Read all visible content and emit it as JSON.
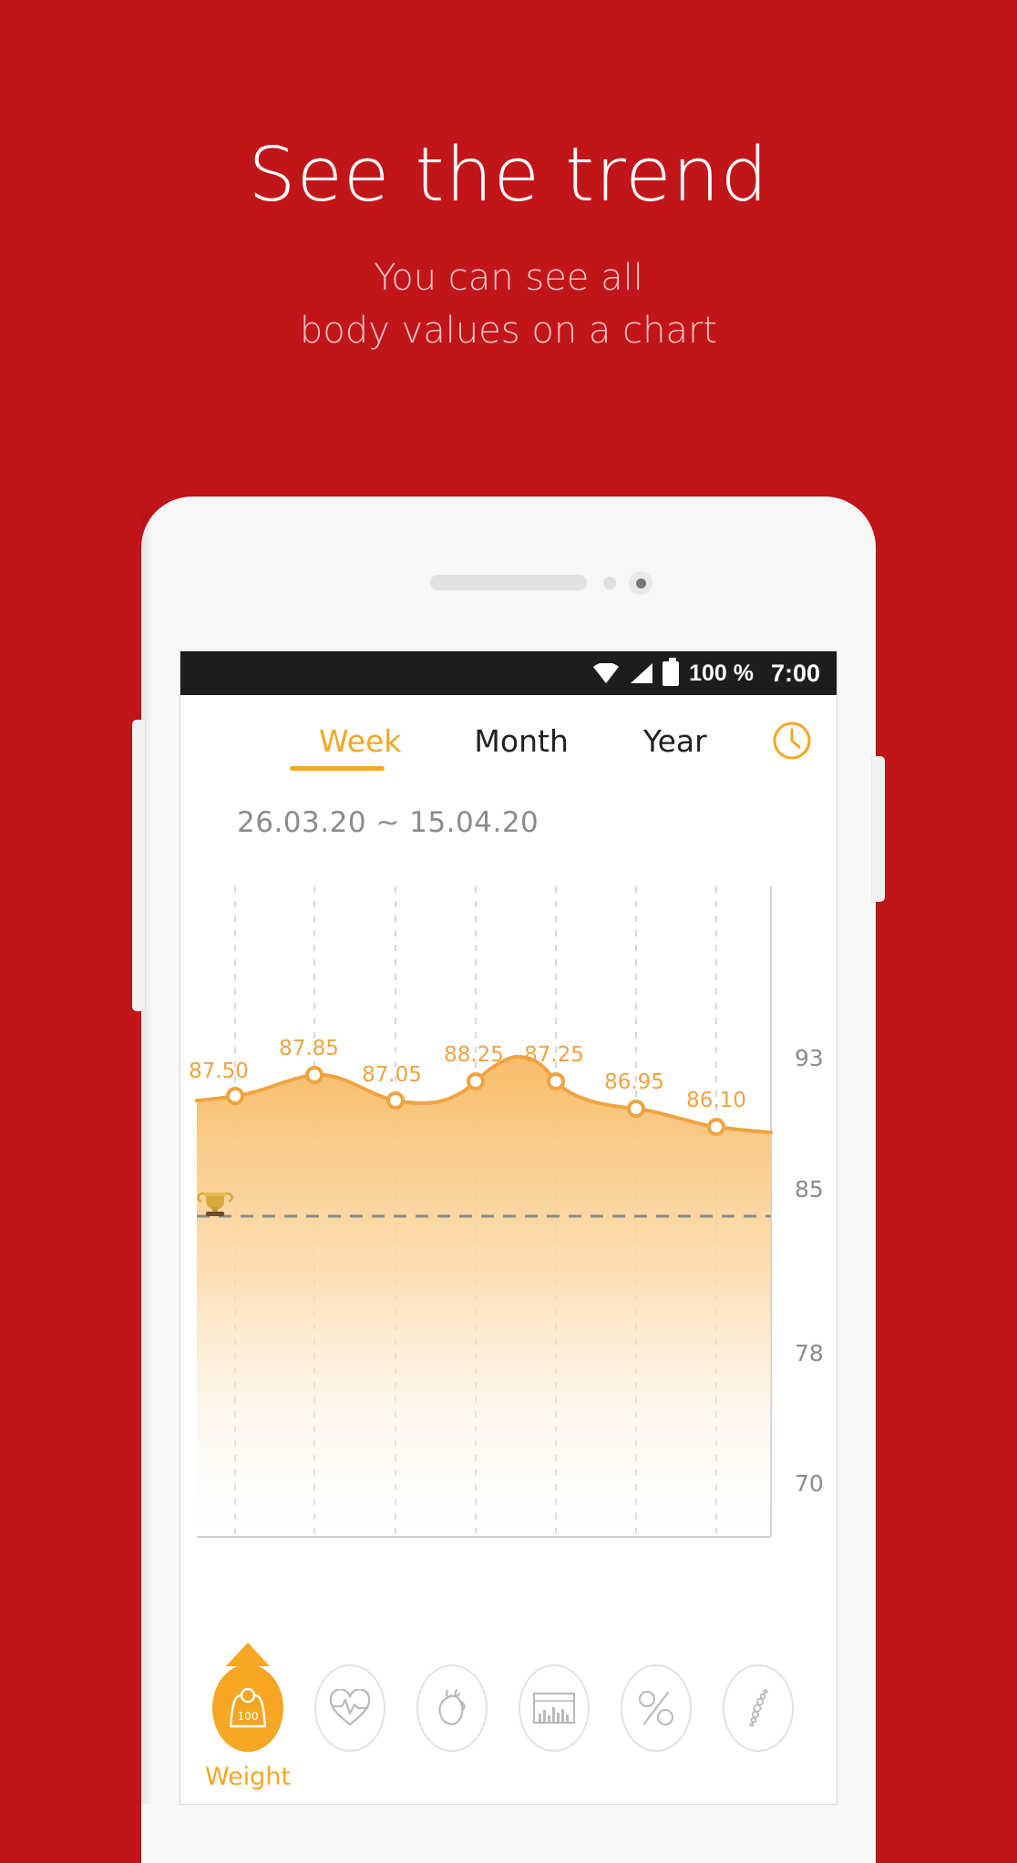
{
  "promo": {
    "title": "See the trend",
    "subtitle_line1": "You can see all",
    "subtitle_line2": "body values on a chart"
  },
  "colors": {
    "background_red": "#c1151a",
    "accent_orange": "#f5a623",
    "area_fill": "#f8c171",
    "muted_gray": "#8b8b8b",
    "statusbar": "#1d1d1d"
  },
  "statusbar": {
    "battery_text": "100 %",
    "time": "7:00",
    "icons": [
      "wifi-icon",
      "signal-icon",
      "battery-icon"
    ]
  },
  "tabs": [
    {
      "label": "Week",
      "active": true
    },
    {
      "label": "Month",
      "active": false
    },
    {
      "label": "Year",
      "active": false
    }
  ],
  "toolbar": {
    "history_icon": "clock-icon"
  },
  "date_range": "26.03.20 ~ 15.04.20",
  "chart_data": {
    "type": "area",
    "title": "",
    "xlabel": "",
    "ylabel": "",
    "ylim": [
      66,
      96
    ],
    "yticks": [
      93,
      85,
      78,
      70
    ],
    "grid": true,
    "gridlines_vertical": 7,
    "legend": "none",
    "unit": "kg",
    "categories": [
      "1",
      "2",
      "3",
      "4",
      "5",
      "6",
      "7"
    ],
    "values": [
      87.5,
      87.85,
      87.05,
      88.25,
      87.25,
      86.95,
      86.1
    ],
    "point_labels": [
      "87.50",
      "87.85",
      "87.05",
      "88.25",
      "87.25",
      "86.95",
      "86.10"
    ],
    "goal_line": {
      "value": 83.2,
      "style": "dashed",
      "marker_icon": "trophy-icon",
      "marker": "🏆"
    }
  },
  "bottom_nav": {
    "active_label": "Weight",
    "items": [
      {
        "icon": "weight-scale-icon",
        "label": "Weight",
        "active": true
      },
      {
        "icon": "heartbeat-icon",
        "label": "",
        "active": false
      },
      {
        "icon": "heart-organ-icon",
        "label": "",
        "active": false
      },
      {
        "icon": "body-chart-icon",
        "label": "",
        "active": false
      },
      {
        "icon": "percent-icon",
        "label": "",
        "active": false
      },
      {
        "icon": "spine-bone-icon",
        "label": "",
        "active": false
      }
    ]
  },
  "weight_icon_value": "100"
}
